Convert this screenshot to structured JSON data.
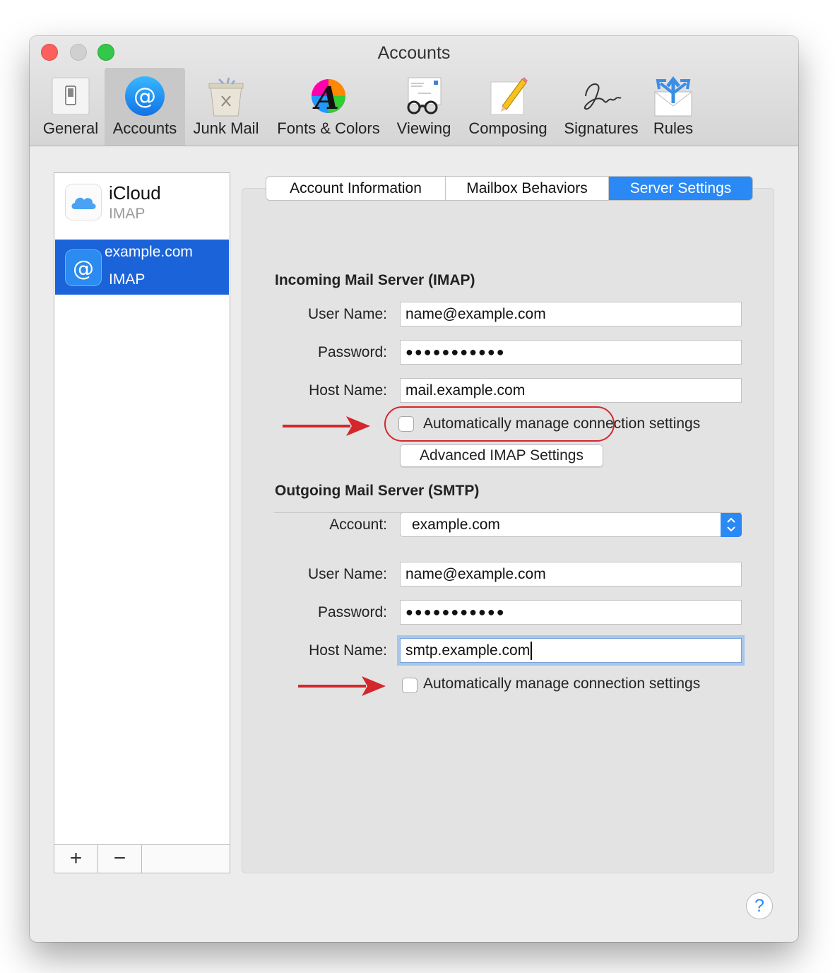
{
  "window": {
    "title": "Accounts"
  },
  "toolbar": {
    "items": [
      {
        "label": "General",
        "icon": "switch-icon"
      },
      {
        "label": "Accounts",
        "icon": "at-sign-icon"
      },
      {
        "label": "Junk Mail",
        "icon": "trash-bin-icon"
      },
      {
        "label": "Fonts & Colors",
        "icon": "font-color-wheel-icon"
      },
      {
        "label": "Viewing",
        "icon": "glasses-letter-icon"
      },
      {
        "label": "Composing",
        "icon": "pencil-paper-icon"
      },
      {
        "label": "Signatures",
        "icon": "signature-icon"
      },
      {
        "label": "Rules",
        "icon": "envelope-arrows-icon"
      }
    ],
    "selected": "Accounts"
  },
  "accounts": [
    {
      "name": "iCloud",
      "type": "IMAP",
      "icon": "cloud-icon"
    },
    {
      "name": "example.com",
      "type": "IMAP",
      "icon": "at-sign-icon",
      "selected": true
    }
  ],
  "list_controls": {
    "add": "+",
    "remove": "−"
  },
  "tabs": [
    {
      "label": "Account Information"
    },
    {
      "label": "Mailbox Behaviors"
    },
    {
      "label": "Server Settings",
      "active": true
    }
  ],
  "incoming": {
    "title": "Incoming Mail Server (IMAP)",
    "username_label": "User Name:",
    "username": "name@example.com",
    "password_label": "Password:",
    "password": "●●●●●●●●●●●",
    "hostname_label": "Host Name:",
    "hostname": "mail.example.com",
    "auto_manage_label": "Automatically manage connection settings",
    "auto_manage_checked": false,
    "advanced_button": "Advanced IMAP Settings"
  },
  "outgoing": {
    "title": "Outgoing Mail Server (SMTP)",
    "account_label": "Account:",
    "account": "example.com",
    "username_label": "User Name:",
    "username": "name@example.com",
    "password_label": "Password:",
    "password": "●●●●●●●●●●●",
    "hostname_label": "Host Name:",
    "hostname": "smtp.example.com",
    "auto_manage_label": "Automatically manage connection settings",
    "auto_manage_checked": false
  },
  "help": "?",
  "colors": {
    "accent": "#2a89f5",
    "selection": "#1b63d9",
    "annotation": "#d4272c"
  }
}
